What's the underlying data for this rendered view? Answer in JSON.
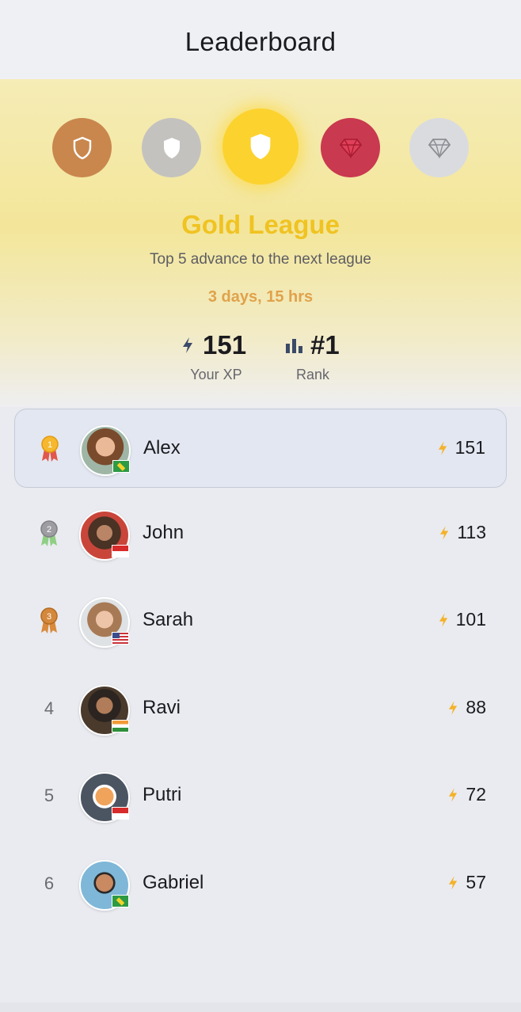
{
  "header": {
    "title": "Leaderboard"
  },
  "leagues": [
    {
      "name": "bronze",
      "color": "#c9874d",
      "icon": "shield-outline-icon"
    },
    {
      "name": "silver",
      "color": "#c4c2bf",
      "icon": "shield-icon"
    },
    {
      "name": "gold",
      "color": "#fcd22f",
      "icon": "shield-icon",
      "selected": true
    },
    {
      "name": "ruby",
      "color": "#c9394f",
      "icon": "gem-icon"
    },
    {
      "name": "diamond",
      "color": "#dadbdf",
      "icon": "gem-outline-icon"
    }
  ],
  "league": {
    "name": "Gold League",
    "subtitle": "Top 5 advance to the next league",
    "time_left": "3 days, 15 hrs"
  },
  "stats": {
    "xp_value": "151",
    "xp_label": "Your XP",
    "rank_value": "#1",
    "rank_label": "Rank"
  },
  "leaderboard": [
    {
      "rank": "1",
      "medal": "gold-medal-icon",
      "name": "Alex",
      "xp": "151",
      "flag": "brazil-flag-icon",
      "current": true
    },
    {
      "rank": "2",
      "medal": "silver-medal-icon",
      "name": "John",
      "xp": "113",
      "flag": "indonesia-flag-icon"
    },
    {
      "rank": "3",
      "medal": "bronze-medal-icon",
      "name": "Sarah",
      "xp": "101",
      "flag": "usa-flag-icon"
    },
    {
      "rank": "4",
      "name": "Ravi",
      "xp": "88",
      "flag": "india-flag-icon"
    },
    {
      "rank": "5",
      "name": "Putri",
      "xp": "72",
      "flag": "indonesia-flag-icon"
    },
    {
      "rank": "6",
      "name": "Gabriel",
      "xp": "57",
      "flag": "brazil-flag-icon"
    }
  ],
  "colors": {
    "accent_gold": "#f0c322",
    "timer": "#e0a24b",
    "lightning": "#f4b22a"
  }
}
